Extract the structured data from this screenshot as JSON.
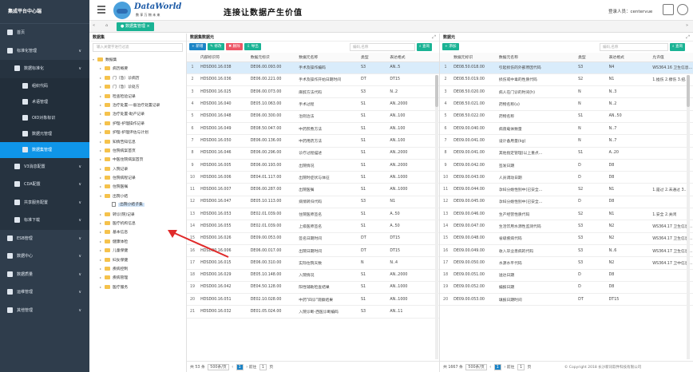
{
  "sidebar": {
    "title": "集成平台中心端",
    "items": [
      {
        "label": "首页",
        "icon": "home-icon",
        "level": 0,
        "active": false,
        "caret": ""
      },
      {
        "label": "标准化管理",
        "icon": "layers-icon",
        "level": 0,
        "active": false,
        "caret": "∨"
      },
      {
        "label": "数据标准化",
        "icon": "grid-icon",
        "level": 1,
        "active": false,
        "caret": "∨"
      },
      {
        "label": "组织代码",
        "icon": "tag-icon",
        "level": 2,
        "active": false,
        "caret": ""
      },
      {
        "label": "术语管理",
        "icon": "tag-icon",
        "level": 2,
        "active": false,
        "caret": ""
      },
      {
        "label": "OID对象标识",
        "icon": "tag-icon",
        "level": 2,
        "active": false,
        "caret": ""
      },
      {
        "label": "数据元管理",
        "icon": "tag-icon",
        "level": 2,
        "active": false,
        "caret": ""
      },
      {
        "label": "数据集管理",
        "icon": "tag-icon",
        "level": 2,
        "active": true,
        "caret": ""
      },
      {
        "label": "V3消息配置",
        "icon": "message-icon",
        "level": 1,
        "active": false,
        "caret": "∨"
      },
      {
        "label": "CDA配置",
        "icon": "document-icon",
        "level": 1,
        "active": false,
        "caret": "∨"
      },
      {
        "label": "共享服务配置",
        "icon": "share-icon",
        "level": 1,
        "active": false,
        "caret": "∨"
      },
      {
        "label": "标准下载",
        "icon": "download-icon",
        "level": 1,
        "active": false,
        "caret": "∨"
      },
      {
        "label": "ESB管理",
        "icon": "bus-icon",
        "level": 0,
        "active": false,
        "caret": "∨"
      },
      {
        "label": "数据中心",
        "icon": "database-icon",
        "level": 0,
        "active": false,
        "caret": "∨"
      },
      {
        "label": "数据质量",
        "icon": "chart-icon",
        "level": 0,
        "active": false,
        "caret": "∨"
      },
      {
        "label": "运维管理",
        "icon": "wrench-icon",
        "level": 0,
        "active": false,
        "caret": "∨"
      },
      {
        "label": "其他管理",
        "icon": "gear-icon",
        "level": 0,
        "active": false,
        "caret": "∨"
      }
    ]
  },
  "header": {
    "logo_text": "DataWorld",
    "logo_sub": "数 享 万 物 未 来",
    "slogan": "连接让数据产生价值",
    "login_label": "登录人员：centervue"
  },
  "tabs": {
    "left_arrow": "«",
    "right_arrow": "»",
    "active_tab": "● 数据集管理 ×"
  },
  "dataset_panel": {
    "title": "数据集",
    "search_placeholder": "输入关键字进行过滤",
    "tree": [
      {
        "label": "数据集",
        "kind": "folder",
        "depth": 0,
        "arrow": "▾",
        "selected": false
      },
      {
        "label": "病历概要",
        "kind": "folder",
        "depth": 1,
        "arrow": "▸",
        "selected": false
      },
      {
        "label": "门（急）诊病历",
        "kind": "folder",
        "depth": 1,
        "arrow": "▸",
        "selected": false
      },
      {
        "label": "门（急）诊处方",
        "kind": "folder",
        "depth": 1,
        "arrow": "▸",
        "selected": false
      },
      {
        "label": "检查检验记录",
        "kind": "folder",
        "depth": 1,
        "arrow": "▸",
        "selected": false
      },
      {
        "label": "治疗处置-一般治疗处置记录",
        "kind": "folder",
        "depth": 1,
        "arrow": "▸",
        "selected": false
      },
      {
        "label": "治疗处置-助产记录",
        "kind": "folder",
        "depth": 1,
        "arrow": "▸",
        "selected": false
      },
      {
        "label": "护理-护理操作记录",
        "kind": "folder",
        "depth": 1,
        "arrow": "▸",
        "selected": false
      },
      {
        "label": "护理-护理评估与计划",
        "kind": "folder",
        "depth": 1,
        "arrow": "▸",
        "selected": false
      },
      {
        "label": "知情告知信息",
        "kind": "folder",
        "depth": 1,
        "arrow": "▸",
        "selected": false
      },
      {
        "label": "住院病案首页",
        "kind": "folder",
        "depth": 1,
        "arrow": "▸",
        "selected": false
      },
      {
        "label": "中医住院病案首页",
        "kind": "folder",
        "depth": 1,
        "arrow": "▸",
        "selected": false
      },
      {
        "label": "入院记录",
        "kind": "folder",
        "depth": 1,
        "arrow": "▸",
        "selected": false
      },
      {
        "label": "住院病程记录",
        "kind": "folder",
        "depth": 1,
        "arrow": "▸",
        "selected": false
      },
      {
        "label": "住院医嘱",
        "kind": "folder",
        "depth": 1,
        "arrow": "▸",
        "selected": false
      },
      {
        "label": "出院小结",
        "kind": "folder",
        "depth": 1,
        "arrow": "▾",
        "selected": false
      },
      {
        "label": "出院小结子集",
        "kind": "file",
        "depth": 2,
        "arrow": "",
        "selected": true
      },
      {
        "label": "转诊(院)记录",
        "kind": "folder",
        "depth": 1,
        "arrow": "▸",
        "selected": false
      },
      {
        "label": "医疗机构信息",
        "kind": "folder",
        "depth": 1,
        "arrow": "▸",
        "selected": false
      },
      {
        "label": "基本信息",
        "kind": "folder",
        "depth": 1,
        "arrow": "▸",
        "selected": false
      },
      {
        "label": "健康体检",
        "kind": "folder",
        "depth": 1,
        "arrow": "▸",
        "selected": false
      },
      {
        "label": "儿童保健",
        "kind": "folder",
        "depth": 1,
        "arrow": "▸",
        "selected": false
      },
      {
        "label": "妇女保健",
        "kind": "folder",
        "depth": 1,
        "arrow": "▸",
        "selected": false
      },
      {
        "label": "疾病控制",
        "kind": "folder",
        "depth": 1,
        "arrow": "▸",
        "selected": false
      },
      {
        "label": "疾病管理",
        "kind": "folder",
        "depth": 1,
        "arrow": "▸",
        "selected": false
      },
      {
        "label": "医疗服务",
        "kind": "folder",
        "depth": 1,
        "arrow": "▸",
        "selected": false
      }
    ]
  },
  "element_panel": {
    "title": "数据集数据元",
    "buttons": {
      "add": "+ 新增",
      "edit": "✎ 修改",
      "delete": "✖ 删除",
      "export": "⇩ 导出"
    },
    "search_placeholder": "编码,名称",
    "search_btn": "⌕ 查询",
    "columns": [
      "",
      "内部标识符",
      "数据元标识",
      "数据元名称",
      "类型",
      "表达格式"
    ],
    "rows": [
      [
        "1",
        "HDSD00.16.038",
        "DE06.00.093.00",
        "手术及操作编码",
        "S3",
        "AN..5"
      ],
      [
        "2",
        "HDSD00.16.036",
        "DE06.00.221.00",
        "手术及操作开始日期时间",
        "DT",
        "DT15"
      ],
      [
        "3",
        "HDSD00.16.025",
        "DE06.00.073.00",
        "麻醉方法代码",
        "S3",
        "N..2"
      ],
      [
        "4",
        "HDSD00.16.040",
        "DE05.10.063.00",
        "手术过程",
        "S1",
        "AN..2000"
      ],
      [
        "5",
        "HDSD00.16.048",
        "DE06.00.300.00",
        "治则治法",
        "S1",
        "AN..100"
      ],
      [
        "6",
        "HDSD00.16.049",
        "DE08.50.047.00",
        "中药煎煮方法",
        "S1",
        "AN..100"
      ],
      [
        "7",
        "HDSD00.16.050",
        "DE06.00.136.00",
        "中药用药方法",
        "S1",
        "AN..100"
      ],
      [
        "8",
        "HDSD00.16.046",
        "DE06.00.296.00",
        "诊疗过程描述",
        "S1",
        "AN..2000"
      ],
      [
        "9",
        "HDSD00.16.005",
        "DE06.00.193.00",
        "出院情况",
        "S1",
        "AN..2000"
      ],
      [
        "10",
        "HDSD00.16.006",
        "DE04.01.117.00",
        "出院时症状与体征",
        "S1",
        "AN..1000"
      ],
      [
        "11",
        "HDSD00.16.007",
        "DE06.00.287.00",
        "出院医嘱",
        "S1",
        "AN..1000"
      ],
      [
        "12",
        "HDSD00.16.047",
        "DE05.10.113.00",
        "病情转归代码",
        "S3",
        "N1"
      ],
      [
        "13",
        "HDSD00.16.053",
        "DE02.01.039.00",
        "住院医师签名",
        "S1",
        "A..50"
      ],
      [
        "14",
        "HDSD00.16.055",
        "DE02.01.039.00",
        "上级医师签名",
        "S1",
        "A..50"
      ],
      [
        "15",
        "HDSD00.16.026",
        "DE09.00.053.00",
        "签名日期时间",
        "DT",
        "DT15"
      ],
      [
        "16",
        "HDSD00.16.006",
        "DE06.00.017.00",
        "出院日期时间",
        "DT",
        "DT15"
      ],
      [
        "17",
        "HDSD00.16.015",
        "DE06.00.310.00",
        "实际住院天数",
        "N",
        "N..4"
      ],
      [
        "18",
        "HDSD00.16.029",
        "DE05.10.148.00",
        "入院情况",
        "S1",
        "AN..2000"
      ],
      [
        "19",
        "HDSD00.16.042",
        "DE04.50.128.00",
        "阳性辅助检查结果",
        "S1",
        "AN..1000"
      ],
      [
        "20",
        "HDSD00.16.051",
        "DE02.10.028.00",
        "中药\"四诊\"观察结果",
        "S1",
        "AN..1000"
      ],
      [
        "21",
        "HDSD00.16.032",
        "DE01.05.024.00",
        "入院诊断-西医诊断编码",
        "S3",
        "AN..11"
      ]
    ],
    "pager": {
      "total": "共 53 条",
      "page_size": "500条/页",
      "prev": "前往",
      "page": "1",
      "suffix": "页"
    }
  },
  "dict_panel": {
    "title": "数据元",
    "buttons": {
      "add": "+ 添加"
    },
    "search_placeholder": "编码,名称",
    "search_btn": "⌕ 查询",
    "columns": [
      "",
      "数据元标识",
      "数据元名称",
      "类型",
      "表达格式",
      "允许值"
    ],
    "rows": [
      [
        "1",
        "DE08.50.018.00",
        "引起损伤的外部原因代码",
        "S3",
        "N4",
        "WS364.16 卫生信息..."
      ],
      [
        "2",
        "DE08.50.019.00",
        "损伤或中毒的性质代码",
        "S2",
        "N1",
        "1.挫伤 2.擦伤 3.扭..."
      ],
      [
        "3",
        "DE08.50.020.00",
        "病人在门诊的时间(h)",
        "N",
        "N..3",
        ""
      ],
      [
        "4",
        "DE08.50.021.00",
        "药物名称(u)",
        "N",
        "N..2",
        ""
      ],
      [
        "5",
        "DE08.50.022.00",
        "药物名称",
        "S1",
        "AN..50",
        ""
      ],
      [
        "6",
        "DE09.00.040.00",
        "病夜载体数量",
        "N",
        "N..7",
        ""
      ],
      [
        "7",
        "DE09.00.041.00",
        "设计备用量(kg)",
        "N",
        "N..7",
        ""
      ],
      [
        "8",
        "DE09.00.041.00",
        "其他指定管理(以上重点...",
        "S1",
        "A..20",
        ""
      ],
      [
        "9",
        "DE09.00.042.00",
        "签发日期",
        "D",
        "D8",
        ""
      ],
      [
        "10",
        "DE09.00.043.00",
        "人员调动日期",
        "D",
        "D8",
        ""
      ],
      [
        "11",
        "DE09.00.044.00",
        "孕妇分娩性别中(已安全...",
        "S2",
        "N1",
        "1.是过 2.未通过 3.."
      ],
      [
        "12",
        "DE09.00.045.00",
        "孕妇分娩性别中(已安全...",
        "D",
        "D8",
        ""
      ],
      [
        "13",
        "DE09.00.046.00",
        "生产经营性质代码",
        "S2",
        "N1",
        "1.安全 2.关闭"
      ],
      [
        "14",
        "DE09.00.047.00",
        "生活饮用水源性监测代码",
        "S3",
        "N2",
        "WS364.17 卫生信息..."
      ],
      [
        "15",
        "DE09.00.048.00",
        "省级疾病代码",
        "S3",
        "N2",
        "WS364.17 卫生信息..."
      ],
      [
        "16",
        "DE09.00.049.00",
        "收入毕业患病的代码",
        "S3",
        "N..6",
        "WS364.17 卫生信息..."
      ],
      [
        "17",
        "DE09.00.050.00",
        "水源水平代码",
        "S3",
        "N2",
        "WS364.17 卫中信息..."
      ],
      [
        "18",
        "DE09.00.051.00",
        "送达日期",
        "D",
        "D8",
        ""
      ],
      [
        "19",
        "DE09.00.052.00",
        "编报日期",
        "D",
        "D8",
        ""
      ],
      [
        "20",
        "DE09.00.053.00",
        "填报日期时间",
        "DT",
        "DT15",
        ""
      ]
    ],
    "pager": {
      "total": "共 1667 条",
      "page_size": "500条/页",
      "prev": "前往",
      "page": "1",
      "suffix": "页"
    }
  },
  "footer": {
    "copyright": "© Copyright 2018 长沙新讯软件科技有限公司"
  },
  "colors": {
    "sidebar": "#2f3d4c",
    "active": "#0f95e8",
    "green": "#1ab394",
    "blue": "#1c84c6",
    "red": "#ed5565",
    "arrow": "#e02a2a"
  }
}
